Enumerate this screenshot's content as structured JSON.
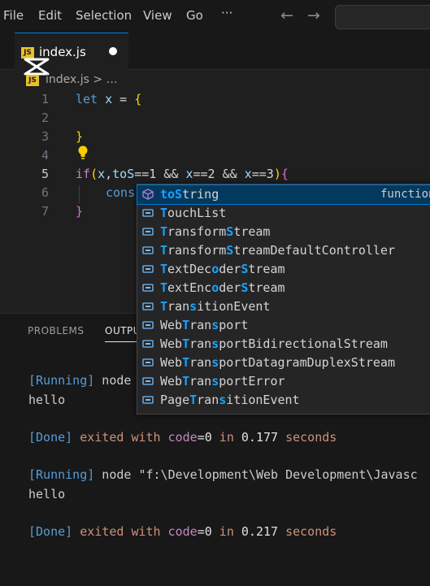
{
  "menu": {
    "file": "File",
    "edit": "Edit",
    "selection": "Selection",
    "view": "View",
    "go": "Go",
    "more": "···"
  },
  "nav": {
    "back": "←",
    "forward": "→"
  },
  "tab": {
    "label": "index.js",
    "badge": "JS"
  },
  "breadcrumb": {
    "file": "index.js",
    "rest": " > …"
  },
  "editor": {
    "line_numbers": [
      "1",
      "2",
      "3",
      "4",
      "5",
      "6",
      "7"
    ],
    "lines": {
      "l1": {
        "kw": "let",
        "var": "x",
        "eq": " = ",
        "brace": "{"
      },
      "l3": {
        "brace": "}"
      },
      "l5": {
        "if": "if",
        "open": "(",
        "x1": "x",
        "comma": ",",
        "tos": "toS",
        "cond1": "==1 && ",
        "x2": "x",
        "cond2": "==2 && ",
        "x3": "x",
        "cond3": "==3",
        "close": ")",
        "brace": "{"
      },
      "l6": {
        "text": "cons"
      },
      "l7": {
        "brace": "}"
      }
    }
  },
  "suggestions": [
    {
      "pre": "",
      "bold1": "toS",
      "post": "tring",
      "detail": "function",
      "icon": "method-icon",
      "selected": true
    },
    {
      "pre": "",
      "bold1": "T",
      "post": "ouchList"
    },
    {
      "pre": "",
      "bold1": "T",
      "post": "ransform",
      "bold2": "S",
      "post2": "tream"
    },
    {
      "pre": "",
      "bold1": "T",
      "post": "ransform",
      "bold2": "S",
      "post2": "treamDefaultController"
    },
    {
      "pre": "",
      "bold1": "T",
      "post": "extDec",
      "bold2": "o",
      "post2": "der",
      "bold3": "S",
      "post3": "tream"
    },
    {
      "pre": "",
      "bold1": "T",
      "post": "extEnc",
      "bold2": "o",
      "post2": "der",
      "bold3": "S",
      "post3": "tream"
    },
    {
      "pre": "",
      "bold1": "T",
      "post": "ran",
      "bold2": "s",
      "post2": "itionEvent"
    },
    {
      "pre": "Web",
      "bold1": "T",
      "post": "ran",
      "bold2": "s",
      "post2": "port"
    },
    {
      "pre": "Web",
      "bold1": "T",
      "post": "ran",
      "bold2": "s",
      "post2": "portBidirectionalStream"
    },
    {
      "pre": "Web",
      "bold1": "T",
      "post": "ran",
      "bold2": "s",
      "post2": "portDatagramDuplexStream"
    },
    {
      "pre": "Web",
      "bold1": "T",
      "post": "ran",
      "bold2": "s",
      "post2": "portError"
    },
    {
      "pre": "Page",
      "bold1": "T",
      "post": "ran",
      "bold2": "s",
      "post2": "itionEvent"
    }
  ],
  "panel": {
    "tabs": {
      "problems": "PROBLEMS",
      "output": "OUTPUT"
    },
    "output": {
      "run1": {
        "tag": "[Running]",
        "cmd": " node"
      },
      "hello1": "hello",
      "done1": {
        "tag": "[Done]",
        "a": " exited ",
        "b": "with",
        "c": " code",
        "d": "=",
        "e": "0",
        "f": " in ",
        "g": "0.177",
        "h": " seconds"
      },
      "run2": {
        "tag": "[Running]",
        "cmd": " node ",
        "path": "\"f:\\Development\\Web Development\\Javasc"
      },
      "hello2": "hello",
      "done2": {
        "tag": "[Done]",
        "a": " exited ",
        "b": "with",
        "c": " code",
        "d": "=",
        "e": "0",
        "f": " in ",
        "g": "0.217",
        "h": " seconds"
      }
    }
  },
  "colors": {
    "accent": "#0078d4",
    "background": "#1f1f1f",
    "suggest_highlight": "#18a3ff",
    "js_badge": "#e8c02b"
  }
}
